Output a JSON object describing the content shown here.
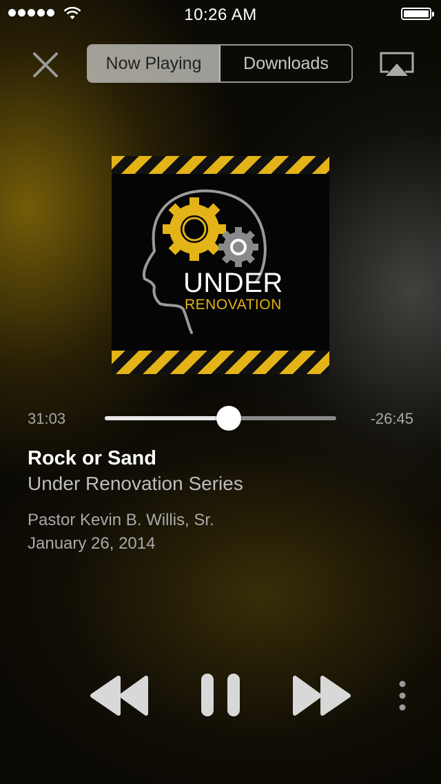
{
  "status_bar": {
    "signal_dots": 5,
    "wifi_icon": "wifi-icon",
    "time": "10:26 AM",
    "battery_icon": "battery-icon"
  },
  "header": {
    "close_icon": "close-icon",
    "tabs": [
      {
        "label": "Now Playing",
        "active": true
      },
      {
        "label": "Downloads",
        "active": false
      }
    ],
    "airplay_icon": "airplay-icon"
  },
  "artwork": {
    "line1": "UNDER",
    "line2": "RENOVATION",
    "accent_color": "#e3b318"
  },
  "progress": {
    "elapsed": "31:03",
    "remaining": "-26:45",
    "fraction": 0.537
  },
  "track": {
    "title": "Rock or Sand",
    "series": "Under Renovation Series",
    "speaker": "Pastor Kevin B. Willis, Sr.",
    "date": "January 26, 2014"
  },
  "controls": {
    "rewind_icon": "rewind-icon",
    "pause_icon": "pause-icon",
    "forward_icon": "fast-forward-icon",
    "more_icon": "more-vertical-icon"
  }
}
